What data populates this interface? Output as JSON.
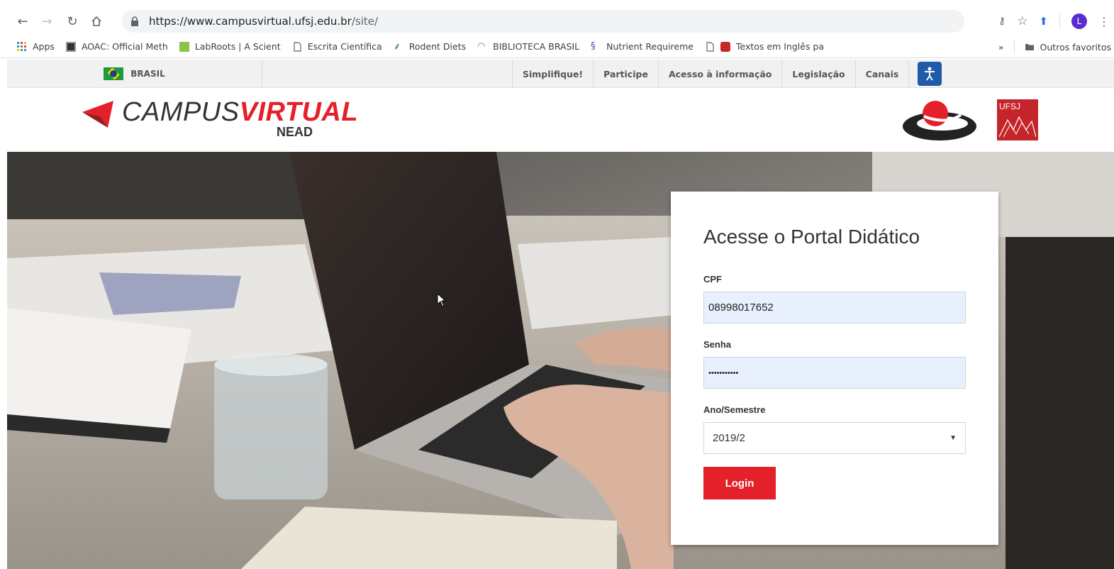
{
  "browser": {
    "url_host": "https://www.campusvirtual.ufsj.edu.br",
    "url_path": "/site/",
    "profile_initial": "L",
    "bookmarks": [
      {
        "label": "Apps"
      },
      {
        "label": "AOAC: Official Meth"
      },
      {
        "label": "LabRoots | A Scient"
      },
      {
        "label": "Escrita Científica"
      },
      {
        "label": "Rodent Diets"
      },
      {
        "label": "BIBLIOTECA BRASIL"
      },
      {
        "label": "Nutrient Requireme"
      },
      {
        "label": "Textos em Inglês pa"
      }
    ],
    "more_bookmarks": "»",
    "other_bookmarks": "Outros favoritos"
  },
  "govbar": {
    "brasil": "BRASIL",
    "links": [
      "Simplifique!",
      "Participe",
      "Acesso à informação",
      "Legislação",
      "Canais"
    ]
  },
  "header": {
    "logo_main": "CAMPUS",
    "logo_accent": "VIRTUAL",
    "logo_sub": "NEAD",
    "ufsj": "UFSJ"
  },
  "login": {
    "title": "Acesse o Portal Didático",
    "cpf_label": "CPF",
    "cpf_value": "08998017652",
    "senha_label": "Senha",
    "senha_value": "•••••••••••",
    "ano_label": "Ano/Semestre",
    "ano_value": "2019/2",
    "button": "Login"
  },
  "colors": {
    "brand_red": "#e4202a",
    "field_bg": "#e8f0fe"
  }
}
